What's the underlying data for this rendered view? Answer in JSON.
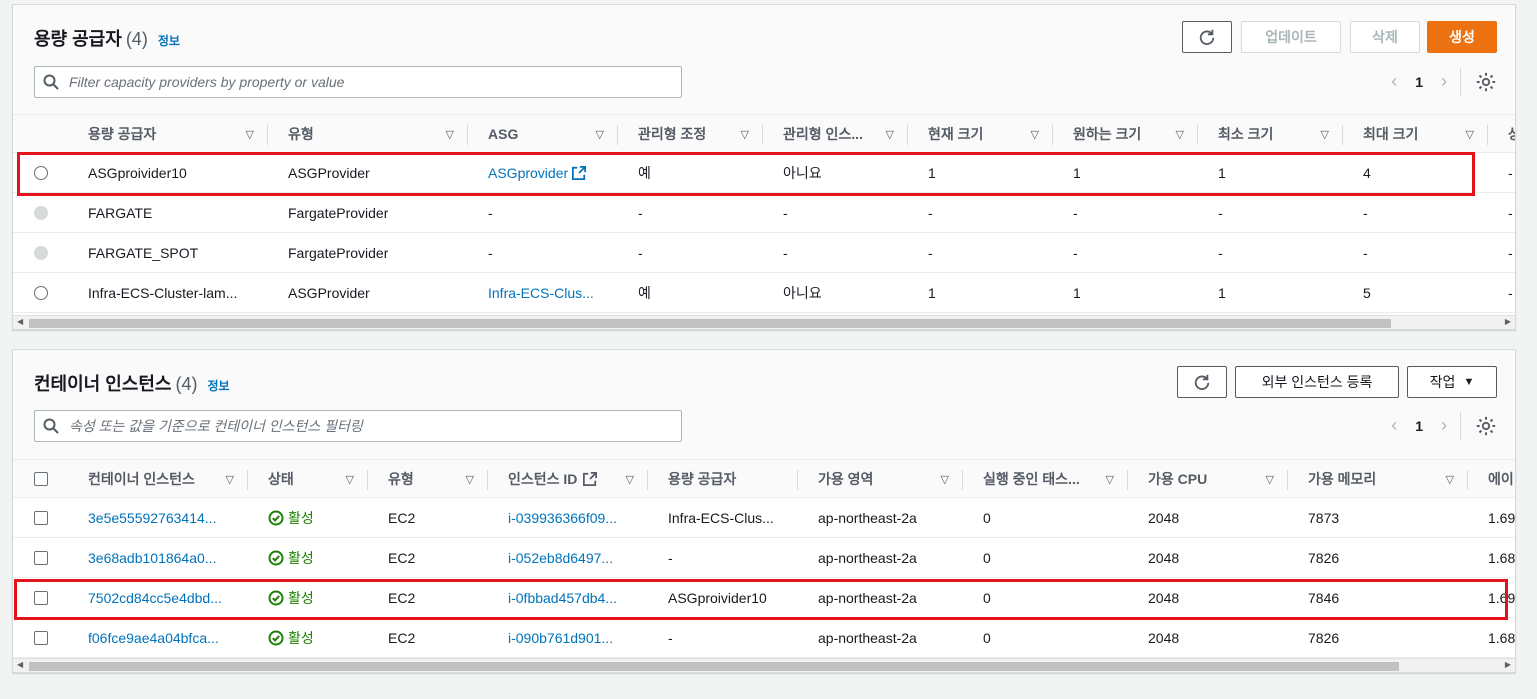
{
  "capacity_providers": {
    "title": "용량 공급자",
    "count": "(4)",
    "info": "정보",
    "buttons": {
      "update": "업데이트",
      "delete": "삭제",
      "create": "생성"
    },
    "filter_placeholder": "Filter capacity providers by property or value",
    "page": "1",
    "columns": [
      "용량 공급자",
      "유형",
      "ASG",
      "관리형 조정",
      "관리형 인스...",
      "현재 크기",
      "원하는 크기",
      "최소 크기",
      "최대 크기",
      "상"
    ],
    "rows": [
      {
        "name": "ASGproivider10",
        "type": "ASGProvider",
        "asg": "ASGprovider",
        "managed_scaling": "예",
        "managed_termination": "아니요",
        "current": "1",
        "desired": "1",
        "min": "1",
        "max": "4",
        "extra": "-"
      },
      {
        "name": "FARGATE",
        "type": "FargateProvider",
        "asg": "-",
        "managed_scaling": "-",
        "managed_termination": "-",
        "current": "-",
        "desired": "-",
        "min": "-",
        "max": "-",
        "extra": "-"
      },
      {
        "name": "FARGATE_SPOT",
        "type": "FargateProvider",
        "asg": "-",
        "managed_scaling": "-",
        "managed_termination": "-",
        "current": "-",
        "desired": "-",
        "min": "-",
        "max": "-",
        "extra": "-"
      },
      {
        "name": "Infra-ECS-Cluster-lam...",
        "type": "ASGProvider",
        "asg": "Infra-ECS-Clus...",
        "managed_scaling": "예",
        "managed_termination": "아니요",
        "current": "1",
        "desired": "1",
        "min": "1",
        "max": "5",
        "extra": "-"
      }
    ]
  },
  "container_instances": {
    "title": "컨테이너 인스턴스",
    "count": "(4)",
    "info": "정보",
    "buttons": {
      "register_external": "외부 인스턴스 등록",
      "actions": "작업"
    },
    "filter_placeholder": "속성 또는 값을 기준으로 컨테이너 인스턴스 필터링",
    "page": "1",
    "columns": [
      "컨테이너 인스턴스",
      "상태",
      "유형",
      "인스턴스 ID",
      "용량 공급자",
      "가용 영역",
      "실행 중인 태스...",
      "가용 CPU",
      "가용 메모리",
      "에이"
    ],
    "rows": [
      {
        "id": "3e5e55592763414...",
        "status": "활성",
        "type": "EC2",
        "instance_id": "i-039936366f09...",
        "provider": "Infra-ECS-Clus...",
        "az": "ap-northeast-2a",
        "running": "0",
        "cpu": "2048",
        "memory": "7873",
        "agent": "1.69"
      },
      {
        "id": "3e68adb101864a0...",
        "status": "활성",
        "type": "EC2",
        "instance_id": "i-052eb8d6497...",
        "provider": "-",
        "az": "ap-northeast-2a",
        "running": "0",
        "cpu": "2048",
        "memory": "7826",
        "agent": "1.68"
      },
      {
        "id": "7502cd84cc5e4dbd...",
        "status": "활성",
        "type": "EC2",
        "instance_id": "i-0fbbad457db4...",
        "provider": "ASGproivider10",
        "az": "ap-northeast-2a",
        "running": "0",
        "cpu": "2048",
        "memory": "7846",
        "agent": "1.69"
      },
      {
        "id": "f06fce9ae4a04bfca...",
        "status": "활성",
        "type": "EC2",
        "instance_id": "i-090b761d901...",
        "provider": "-",
        "az": "ap-northeast-2a",
        "running": "0",
        "cpu": "2048",
        "memory": "7826",
        "agent": "1.68"
      }
    ]
  },
  "colors": {
    "accent": "#ec7211",
    "link": "#0073bb",
    "success": "#1d8102",
    "highlight": "#e3121b"
  }
}
